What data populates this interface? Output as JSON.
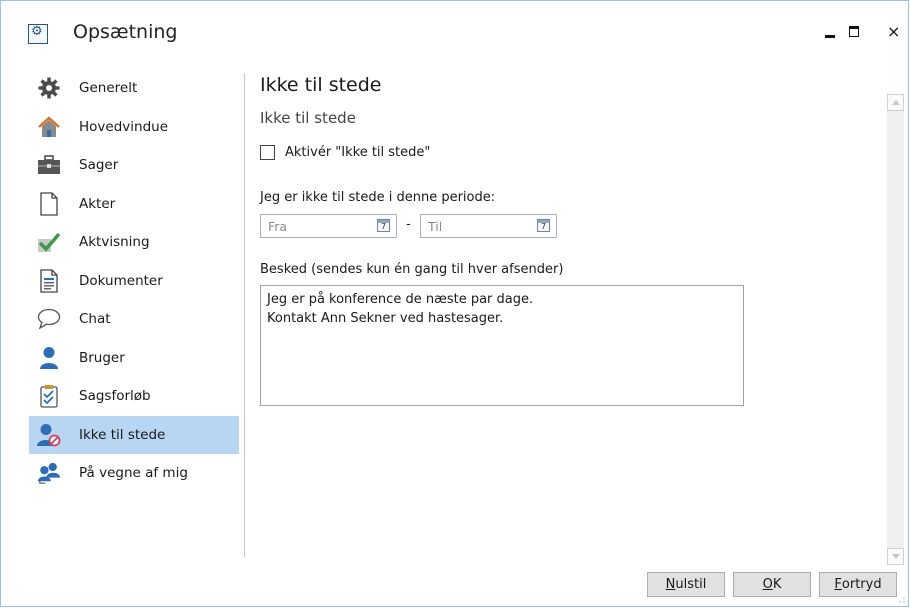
{
  "window": {
    "title": "Opsætning",
    "icon": "settings-app-icon",
    "close_glyph": "×"
  },
  "sidebar": {
    "items": [
      {
        "label": "Generelt",
        "icon": "gear-icon"
      },
      {
        "label": "Hovedvindue",
        "icon": "home-icon"
      },
      {
        "label": "Sager",
        "icon": "briefcase-icon"
      },
      {
        "label": "Akter",
        "icon": "document-icon"
      },
      {
        "label": "Aktvisning",
        "icon": "checkmark-icon"
      },
      {
        "label": "Dokumenter",
        "icon": "text-document-icon"
      },
      {
        "label": "Chat",
        "icon": "chat-bubble-icon"
      },
      {
        "label": "Bruger",
        "icon": "user-icon"
      },
      {
        "label": "Sagsforløb",
        "icon": "clipboard-checklist-icon"
      },
      {
        "label": "Ikke til stede",
        "icon": "user-unavailable-icon",
        "selected": true
      },
      {
        "label": "På vegne af mig",
        "icon": "users-delegate-icon"
      }
    ]
  },
  "content": {
    "title": "Ikke til stede",
    "section_title": "Ikke til stede",
    "activate_checkbox": {
      "label": "Aktivér \"Ikke til stede\"",
      "checked": false
    },
    "period_label": "Jeg er ikke til stede i denne periode:",
    "from": {
      "placeholder": "Fra",
      "value": ""
    },
    "separator": "-",
    "to": {
      "placeholder": "Til",
      "value": ""
    },
    "message_label": "Besked (sendes kun én gang til hver afsender)",
    "message_lines": [
      "Jeg er på konference de næste par dage.",
      "Kontakt Ann Sekner ved hastesager."
    ]
  },
  "footer": {
    "reset": {
      "accel": "N",
      "rest": "ulstil"
    },
    "ok": {
      "accel": "O",
      "rest": "K"
    },
    "cancel": {
      "accel": "F",
      "rest": "ortryd"
    }
  },
  "colors": {
    "selected_bg": "#b8d5f2",
    "accent_blue": "#2e6db4"
  }
}
